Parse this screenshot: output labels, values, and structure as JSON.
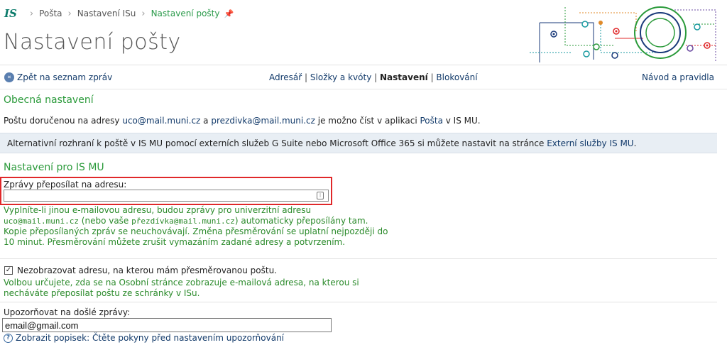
{
  "header": {
    "logo": "IS",
    "breadcrumb": [
      "Pošta",
      "Nastavení ISu",
      "Nastavení pošty"
    ],
    "title": "Nastavení pošty"
  },
  "nav": {
    "back": "Zpět na seznam zpráv",
    "tabs": [
      "Adresář",
      "Složky a kvóty",
      "Nastavení",
      "Blokování"
    ],
    "active_tab": "Nastavení",
    "help": "Návod a pravidla"
  },
  "general": {
    "heading": "Obecná nastavení",
    "p1_a": "Poštu doručenou na adresy ",
    "addr1": "uco@mail.muni.cz",
    "p1_b": " a ",
    "addr2": "prezdivka@mail.muni.cz",
    "p1_c": " je možno číst v aplikaci ",
    "app": "Pošta",
    "p1_d": " v IS MU.",
    "notice_a": "Alternativní rozhraní k poště v IS MU pomocí externích služeb G Suite nebo Microsoft Office 365 si můžete nastavit na stránce ",
    "notice_link": "Externí služby IS MU",
    "notice_b": "."
  },
  "ismu": {
    "heading": "Nastavení pro IS MU",
    "forward_label": "Zprávy přeposílat na adresu:",
    "forward_value": "",
    "help1": "Vyplníte-li jinou e-mailovou adresu, budou zprávy pro univerzitní adresu",
    "help2_mono1": "uco@mail.muni.cz",
    "help2_a": " (nebo vaše ",
    "help2_mono2": "přezdívka@mail.muni.cz",
    "help2_b": ") automaticky přeposílány tam.",
    "help3": "Kopie přeposílaných zpráv se neuchovávají. Změna přesměrování se uplatní nejpozději do",
    "help4": "10 minut. Přesměrování můžete zrušit vymazáním zadané adresy a potvrzením.",
    "hide_checkbox_label": "Nezobrazovat adresu, na kterou mám přesměrovanou poštu.",
    "hide_checked": true,
    "hide_help1": "Volbou určujete, zda se na Osobní stránce zobrazuje e-mailová adresa, na kterou si",
    "hide_help2": "necháváte přeposílat poštu ze schránky v ISu.",
    "notify_label": "Upozorňovat na došlé zprávy:",
    "notify_value": "email@gmail.com",
    "tip_text": "Zobrazit popisek: Čtěte pokyny před nastavením upozorňování"
  },
  "colors": {
    "green": "#2a9a3a",
    "link": "#123a6a",
    "highlight": "#e0282a"
  }
}
